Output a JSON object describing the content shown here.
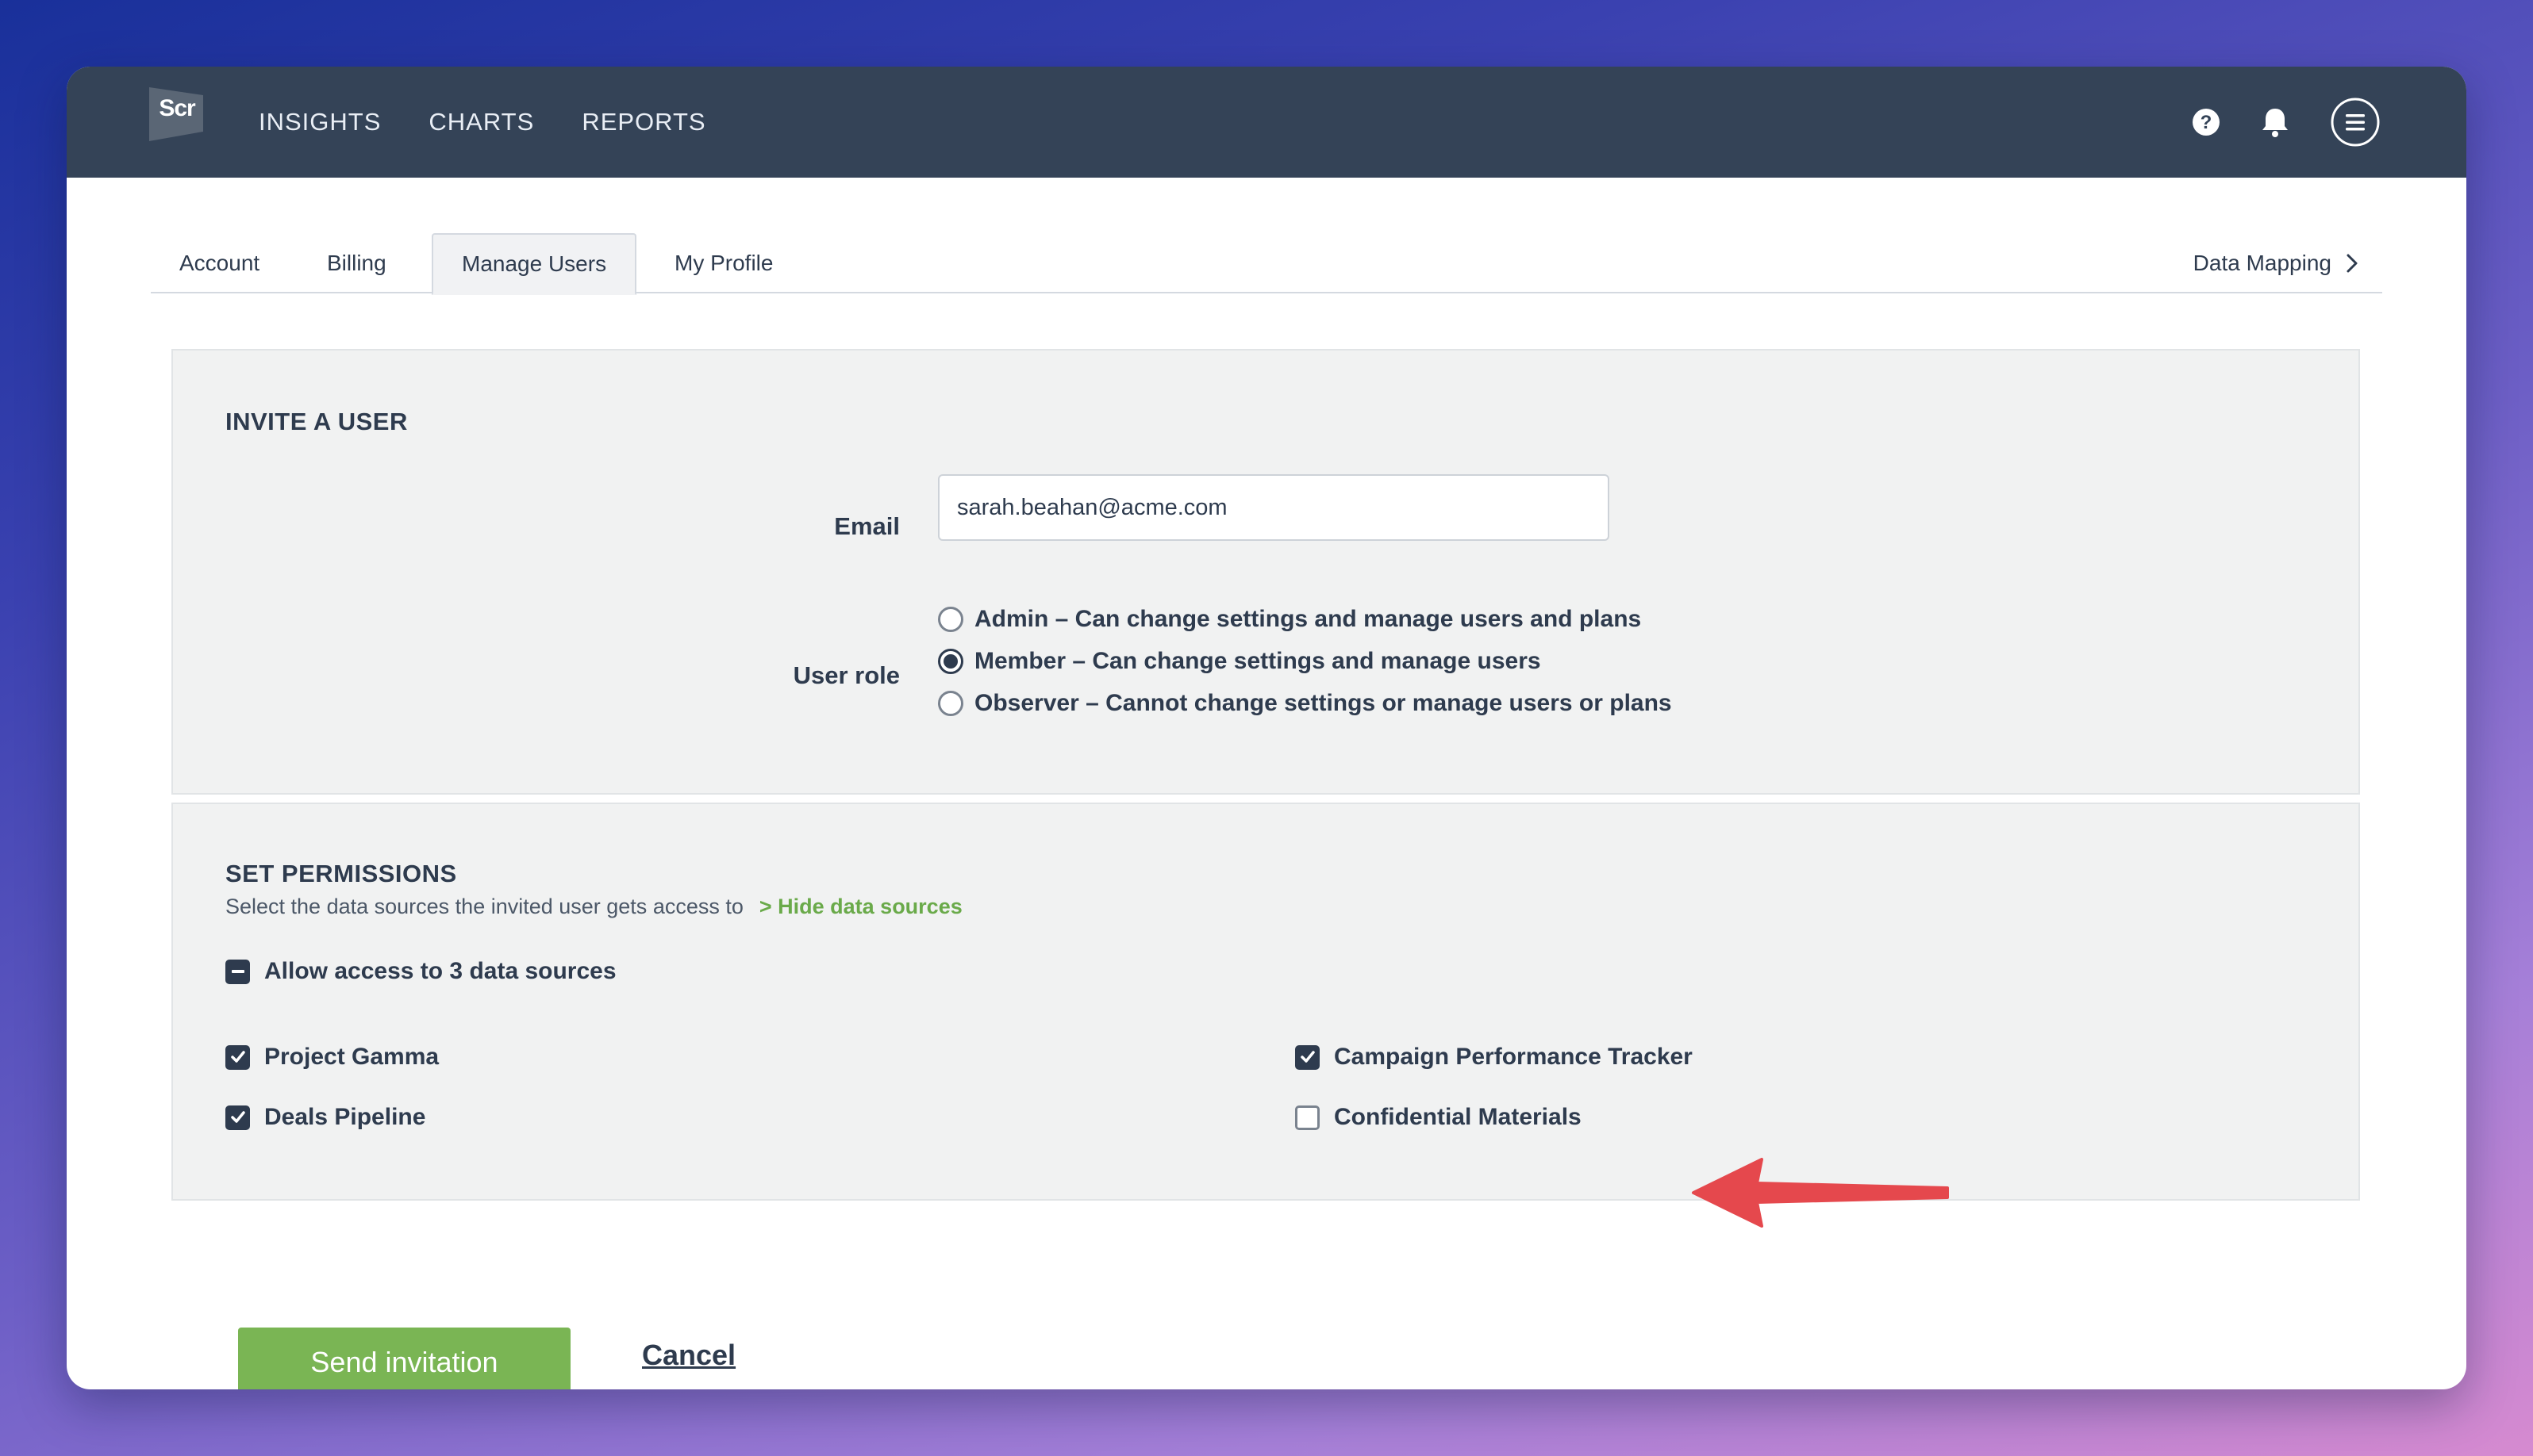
{
  "app": {
    "logo_text": "Scr",
    "nav": [
      "INSIGHTS",
      "CHARTS",
      "REPORTS"
    ],
    "icons": [
      "help-icon",
      "bell-icon",
      "menu-icon"
    ]
  },
  "tabs": {
    "items": [
      "Account",
      "Billing",
      "Manage Users",
      "My Profile"
    ],
    "active": "Manage Users",
    "data_mapping": "Data Mapping"
  },
  "invite": {
    "title": "INVITE A USER",
    "email_label": "Email",
    "email_value": "sarah.beahan@acme.com",
    "role_label": "User role",
    "roles": [
      {
        "label": "Admin – Can change settings and manage users and plans",
        "checked": false
      },
      {
        "label": "Member – Can change settings and manage users",
        "checked": true
      },
      {
        "label": "Observer – Cannot change settings or manage users or plans",
        "checked": false
      }
    ]
  },
  "permissions": {
    "title": "SET PERMISSIONS",
    "subtitle": "Select the data sources the invited user gets access to",
    "hide_link": "> Hide data sources",
    "allow_all_label": "Allow access to 3 data sources",
    "sources": [
      {
        "label": "Project Gamma",
        "checked": true
      },
      {
        "label": "Deals Pipeline",
        "checked": true
      },
      {
        "label": "Campaign Performance Tracker",
        "checked": true
      },
      {
        "label": "Confidential Materials",
        "checked": false
      }
    ]
  },
  "actions": {
    "send": "Send invitation",
    "cancel": "Cancel"
  },
  "colors": {
    "topbar": "#344357",
    "accent_green": "#7ab554",
    "link_green": "#6aaa4a",
    "annotation_arrow": "#e5484d"
  }
}
